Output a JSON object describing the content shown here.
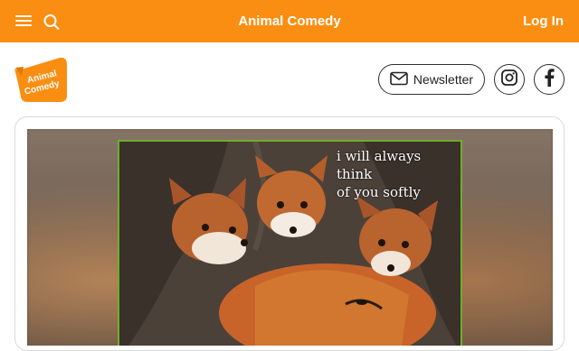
{
  "header": {
    "menu_icon": "hamburger-menu-icon",
    "search_icon": "search-icon",
    "title": "Animal Comedy",
    "login_label": "Log In",
    "bg_color": "#f98e12"
  },
  "logo": {
    "line1": "Animal",
    "line2": "Comedy",
    "color": "#f98e12"
  },
  "actions": {
    "newsletter_label": "Newsletter",
    "newsletter_icon": "envelope-icon",
    "instagram_icon": "instagram-icon",
    "facebook_icon": "facebook-icon"
  },
  "post": {
    "caption_line1": "i will always think",
    "caption_line2": "of you softly",
    "frame_color": "#6fae2a"
  }
}
